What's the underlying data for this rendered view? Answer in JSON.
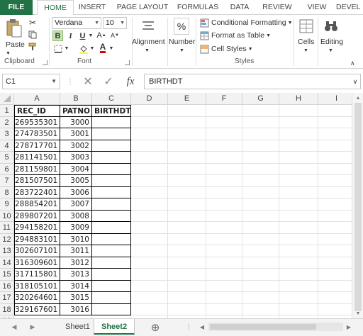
{
  "ribbon": {
    "tabs": [
      "FILE",
      "HOME",
      "INSERT",
      "PAGE LAYOUT",
      "FORMULAS",
      "DATA",
      "REVIEW",
      "DEVEL"
    ],
    "clipboard": {
      "paste": "Paste",
      "label": "Clipboard"
    },
    "font": {
      "name": "Verdana",
      "size": "10",
      "bold": "B",
      "italic": "I",
      "underline": "U",
      "label": "Font"
    },
    "alignment": {
      "label": "Alignment"
    },
    "number": {
      "label": "Number",
      "icon_glyph": "%"
    },
    "styles": {
      "conditional": "Conditional Formatting",
      "format_table": "Format as Table",
      "cell_styles": "Cell Styles",
      "label": "Styles"
    },
    "cells": {
      "label": "Cells"
    },
    "editing": {
      "label": "Editing"
    }
  },
  "formula_bar": {
    "name_box": "C1",
    "fx": "fx",
    "content": "BIRTHDT"
  },
  "columns": [
    "A",
    "B",
    "C",
    "D",
    "E",
    "F",
    "G",
    "H",
    "I"
  ],
  "rows": [
    "1",
    "2",
    "3",
    "4",
    "5",
    "6",
    "7",
    "8",
    "9",
    "10",
    "11",
    "12",
    "13",
    "14",
    "15",
    "16",
    "17",
    "18",
    "19"
  ],
  "table": {
    "headers": [
      "REC_ID",
      "PATNO",
      "BIRTHDT"
    ],
    "rec_ids": [
      "269535301",
      "274783501",
      "278717701",
      "281141501",
      "281159801",
      "281507501",
      "283722401",
      "288854201",
      "289807201",
      "294158201",
      "294883101",
      "302607101",
      "316309601",
      "317115801",
      "318105101",
      "320264601",
      "329167601"
    ],
    "patnos": [
      "3000",
      "3001",
      "3002",
      "3003",
      "3004",
      "3005",
      "3006",
      "3007",
      "3008",
      "3009",
      "3010",
      "3011",
      "3012",
      "3013",
      "3014",
      "3015",
      "3016"
    ]
  },
  "sheets": {
    "tabs": [
      "Sheet1",
      "Sheet2"
    ],
    "active": "Sheet2",
    "add": "⊕"
  },
  "colors": {
    "excel_green": "#217346",
    "font_red": "#e00000"
  }
}
